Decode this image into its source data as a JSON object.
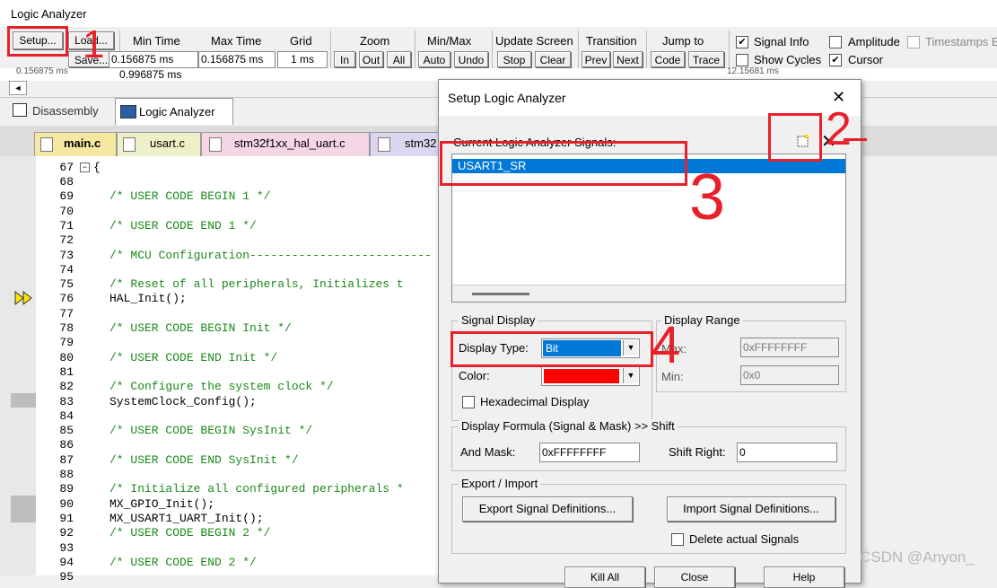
{
  "window": {
    "title": "Logic Analyzer"
  },
  "toolbar": {
    "setup": "Setup...",
    "load": "Load...",
    "save": "Save...",
    "min_time_label": "Min Time",
    "min_time_value": "0.156875 ms",
    "max_time_label": "Max Time",
    "max_time_value": "0.156875 ms",
    "grid_label": "Grid",
    "grid_value": "1 ms",
    "zoom_label": "Zoom",
    "zoom_in": "In",
    "zoom_out": "Out",
    "zoom_all": "All",
    "minmax_label": "Min/Max",
    "auto": "Auto",
    "undo": "Undo",
    "update_label": "Update Screen",
    "stop": "Stop",
    "clear": "Clear",
    "transition_label": "Transition",
    "prev": "Prev",
    "next": "Next",
    "jump_label": "Jump to",
    "code": "Code",
    "trace": "Trace",
    "signal_info": "Signal Info",
    "show_cycles": "Show Cycles",
    "amplitude": "Amplitude",
    "timestamps": "Timestamps E",
    "cursor": "Cursor",
    "check_mark": "✔",
    "ruler_left": "0.996875 ms",
    "ruler_right": "12.15681 ms",
    "ruler_partial": "0.156875 ms"
  },
  "view_tabs": {
    "disassembly": "Disassembly",
    "logic_analyzer": "Logic Analyzer"
  },
  "file_tabs": [
    "main.c",
    "usart.c",
    "stm32f1xx_hal_uart.c",
    "stm32"
  ],
  "code": {
    "first_line": "67",
    "first_text": "{",
    "lines": [
      {
        "n": "68",
        "t": ""
      },
      {
        "n": "69",
        "t": "/* USER CODE BEGIN 1 */",
        "c": true
      },
      {
        "n": "70",
        "t": ""
      },
      {
        "n": "71",
        "t": "/* USER CODE END 1 */",
        "c": true
      },
      {
        "n": "72",
        "t": ""
      },
      {
        "n": "73",
        "t": "/* MCU Configuration--------------------------",
        "c": true
      },
      {
        "n": "74",
        "t": ""
      },
      {
        "n": "75",
        "t": "/* Reset of all peripherals, Initializes t",
        "c": true
      },
      {
        "n": "76",
        "t": "HAL_Init();"
      },
      {
        "n": "77",
        "t": ""
      },
      {
        "n": "78",
        "t": "/* USER CODE BEGIN Init */",
        "c": true
      },
      {
        "n": "79",
        "t": ""
      },
      {
        "n": "80",
        "t": "/* USER CODE END Init */",
        "c": true
      },
      {
        "n": "81",
        "t": ""
      },
      {
        "n": "82",
        "t": "/* Configure the system clock */",
        "c": true
      },
      {
        "n": "83",
        "t": "SystemClock_Config();"
      },
      {
        "n": "84",
        "t": ""
      },
      {
        "n": "85",
        "t": "/* USER CODE BEGIN SysInit */",
        "c": true
      },
      {
        "n": "86",
        "t": ""
      },
      {
        "n": "87",
        "t": "/* USER CODE END SysInit */",
        "c": true
      },
      {
        "n": "88",
        "t": ""
      },
      {
        "n": "89",
        "t": "/* Initialize all configured peripherals *",
        "c": true
      },
      {
        "n": "90",
        "t": "MX_GPIO_Init();"
      },
      {
        "n": "91",
        "t": "MX_USART1_UART_Init();"
      },
      {
        "n": "92",
        "t": "/* USER CODE BEGIN 2 */",
        "c": true
      },
      {
        "n": "93",
        "t": ""
      },
      {
        "n": "94",
        "t": "/* USER CODE END 2 */",
        "c": true
      },
      {
        "n": "95",
        "t": ""
      }
    ]
  },
  "dialog": {
    "title": "Setup Logic Analyzer",
    "close": "✕",
    "signals_label": "Current Logic Analyzer Signals:",
    "signal_item": "USART1_SR",
    "delete_icon": "✕",
    "signal_display": "Signal Display",
    "display_type_label": "Display Type:",
    "display_type_value": "Bit",
    "color_label": "Color:",
    "color_value": "#ff0000",
    "hex_display": "Hexadecimal Display",
    "display_range": "Display Range",
    "max_label": "Max:",
    "max_value": "0xFFFFFFFF",
    "min_label": "Min:",
    "min_value": "0x0",
    "formula": "Display Formula (Signal & Mask) >> Shift",
    "and_mask_label": "And Mask:",
    "and_mask_value": "0xFFFFFFFF",
    "shift_label": "Shift Right:",
    "shift_value": "0",
    "export_import": "Export / Import",
    "export": "Export Signal Definitions...",
    "import": "Import Signal Definitions...",
    "delete_actual": "Delete actual Signals",
    "kill_all": "Kill All",
    "close_btn": "Close",
    "help": "Help"
  },
  "annotations": {
    "n1": "1",
    "n2": "2",
    "n3": "3",
    "n4": "4"
  },
  "watermark": "CSDN @Anyon_",
  "colors": {
    "selection": "#0078d7",
    "annotation": "#e8202a",
    "comment": "#1a8a1a"
  }
}
